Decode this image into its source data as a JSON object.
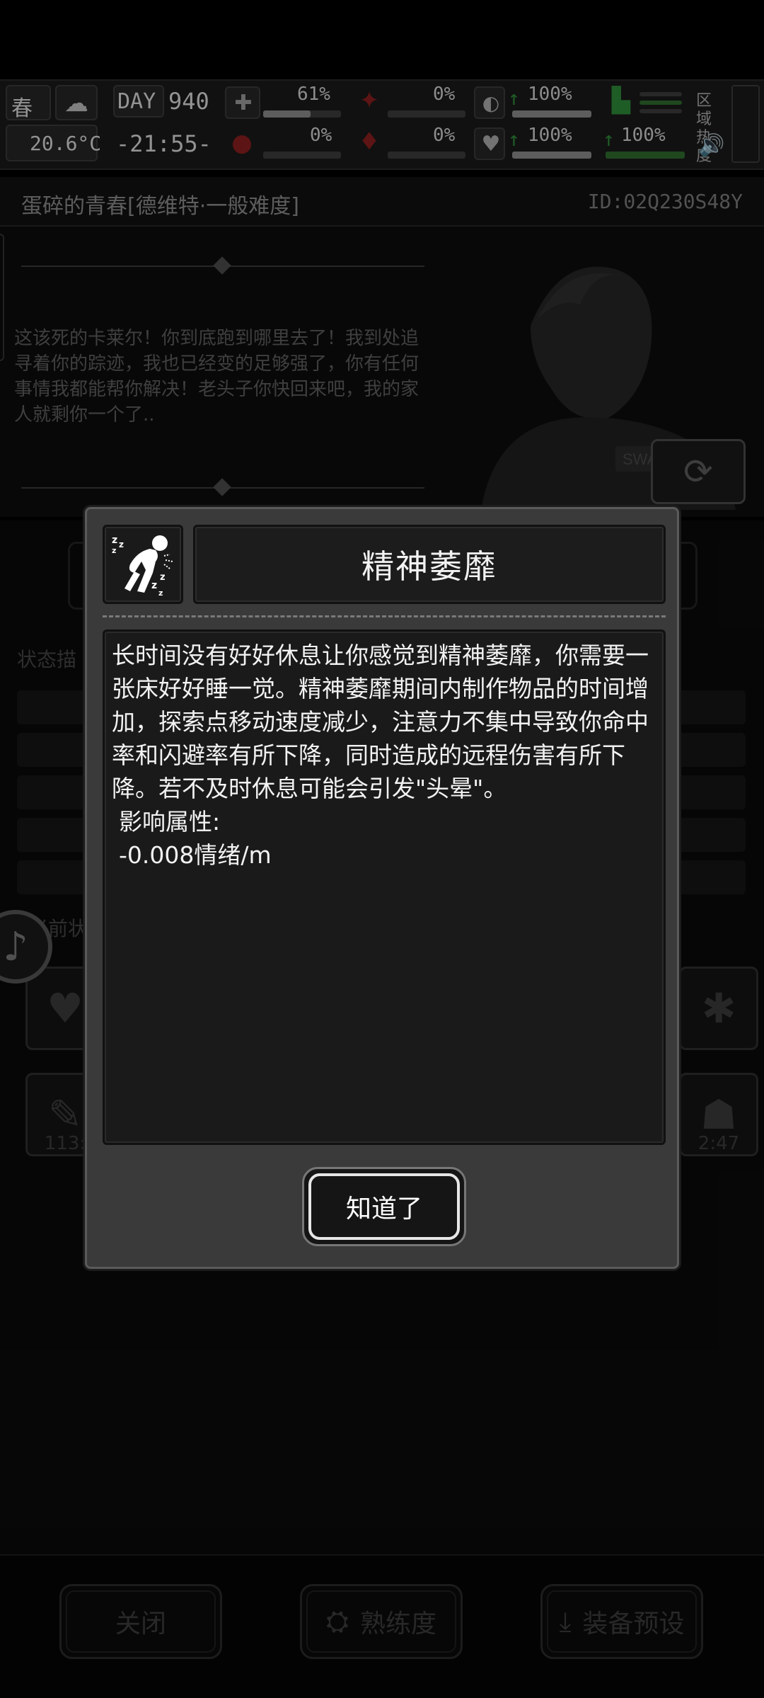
{
  "hud": {
    "season": "春",
    "day_label": "DAY",
    "day_value": "940",
    "temperature": "20.6°C",
    "time": "-21:55-",
    "health_pct": "61%",
    "hunger_pct": "0%",
    "injury_pct": "0%",
    "thirst_pct": "0%",
    "stamina_pct": "100%",
    "mood_pct": "100%",
    "energy_pct": "100%",
    "region_label": "区域热度",
    "health_fill": 0.61,
    "hunger_fill": 0.0,
    "injury_fill": 0.0,
    "thirst_fill": 0.0,
    "stamina_fill": 1.0,
    "mood_fill": 1.0,
    "energy_fill": 1.0
  },
  "save": {
    "title": "蛋碎的青春[德维特·一般难度]",
    "id": "ID:02Q230S48Y"
  },
  "story": {
    "text": "这该死的卡莱尔！你到底跑到哪里去了！我到处追寻着你的踪迹，我也已经变的足够强了，你有任何事情我都能帮你解决！老头子你快回来吧，我的家人就剩你一个了.."
  },
  "background": {
    "status_label": "状态描",
    "current_label": "当前状",
    "tile_left_time": "113:",
    "tile_right_time": "2:47"
  },
  "modal": {
    "title": "精神萎靡",
    "description": "长时间没有好好休息让你感觉到精神萎靡，你需要一张床好好睡一觉。精神萎靡期间内制作物品的时间增加，探索点移动速度减少，注意力不集中导致你命中率和闪避率有所下降，同时造成的远程伤害有所下降。若不及时休息可能会引发\"头晕\"。",
    "attr_heading": "影响属性:",
    "attr_value": "-0.008情绪/m",
    "confirm_label": "知道了"
  },
  "bottom": {
    "close_label": "关闭",
    "proficiency_label": "熟练度",
    "preset_label": "装备预设"
  },
  "icons": {
    "modal_icon": "tired-person-icon",
    "swap_icon": "swap-outfit-icon"
  },
  "colors": {
    "modal_bg": "#3a3a3a",
    "panel_bg": "#1a1a1a",
    "text_white": "#f2f2f2",
    "accent_red": "#8a1e1e",
    "accent_green": "#2f8a3a"
  }
}
